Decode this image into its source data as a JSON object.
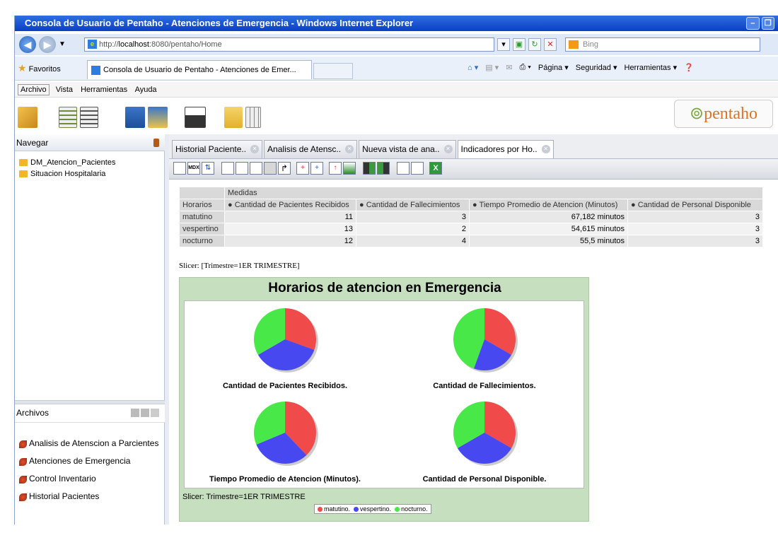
{
  "browser": {
    "window_title": "Consola de Usuario de Pentaho - Atenciones de Emergencia - Windows Internet Explorer",
    "url_prefix": "http://",
    "url_host": "localhost",
    "url_rest": ":8080/pentaho/Home",
    "search_placeholder": "Bing",
    "favorites_label": "Favoritos",
    "tab_title": "Consola de Usuario de Pentaho - Atenciones de Emer...",
    "commands": [
      "Página ▾",
      "Seguridad ▾",
      "Herramientas ▾"
    ]
  },
  "menu": [
    "Archivo",
    "Vista",
    "Herramientas",
    "Ayuda"
  ],
  "logo": {
    "mark": "⊚",
    "text": "pentaho"
  },
  "navigate": {
    "header": "Navegar",
    "folders": [
      "DM_Atencion_Pacientes",
      "Situacion Hospitalaria"
    ]
  },
  "files": {
    "header": "Archivos",
    "items": [
      "Analisis de Atenscion a Parcientes",
      "Atenciones de Emergencia",
      "Control Inventario",
      "Historial Pacientes"
    ]
  },
  "tabs": [
    {
      "label": "Historial Paciente.."
    },
    {
      "label": "Analisis de Atensc.."
    },
    {
      "label": "Nueva vista de ana.."
    },
    {
      "label": "Indicadores por Ho.."
    }
  ],
  "pivot": {
    "measures_label": "Medidas",
    "row_header": "Horarios",
    "columns": [
      "● Cantidad de Pacientes Recibidos",
      "● Cantidad de Fallecimientos",
      "● Tiempo Promedio de Atencion (Minutos)",
      "● Cantidad de Personal Disponible"
    ],
    "rows": [
      {
        "name": "matutino",
        "v1": "11",
        "v2": "3",
        "v3": "67,182 minutos",
        "v4": "3"
      },
      {
        "name": "vespertino",
        "v1": "13",
        "v2": "2",
        "v3": "54,615 minutos",
        "v4": "3"
      },
      {
        "name": "nocturno",
        "v1": "12",
        "v2": "4",
        "v3": "55,5 minutos",
        "v4": "3"
      }
    ],
    "slicer": "Slicer: [Trimestre=1ER TRIMESTRE]"
  },
  "chart_data": {
    "type": "pie",
    "title": "Horarios de atencion en Emergencia",
    "categories": [
      "matutino",
      "vespertino",
      "nocturno"
    ],
    "colors": [
      "#f04a4a",
      "#4848f0",
      "#48e848"
    ],
    "series": [
      {
        "name": "Cantidad de Pacientes Recibidos.",
        "values": [
          11,
          13,
          12
        ]
      },
      {
        "name": "Cantidad de Fallecimientos.",
        "values": [
          3,
          2,
          4
        ]
      },
      {
        "name": "Tiempo Promedio de Atencion (Minutos).",
        "values": [
          67.182,
          54.615,
          55.5
        ]
      },
      {
        "name": "Cantidad de Personal Disponible.",
        "values": [
          3,
          3,
          3
        ]
      }
    ],
    "legend_position": "bottom",
    "slicer": "Slicer: Trimestre=1ER TRIMESTRE",
    "legend_labels": [
      "matutino.",
      "vespertino.",
      "nocturno."
    ]
  }
}
